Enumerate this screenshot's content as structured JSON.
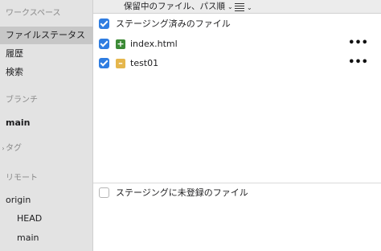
{
  "sidebar": {
    "workspace_header": "ワークスペース",
    "items": [
      {
        "label": "ファイルステータス",
        "selected": true
      },
      {
        "label": "履歴"
      },
      {
        "label": "検索"
      }
    ],
    "branches_header": "ブランチ",
    "current_branch": "main",
    "tags_header": "タグ",
    "remotes_header": "リモート",
    "remote_name": "origin",
    "remote_branches": [
      "HEAD",
      "main"
    ]
  },
  "toolbar": {
    "sort_label": "保留中のファイル、パス順",
    "chevron_icon": "chevron-down-icon",
    "view_icon": "list-icon"
  },
  "staged": {
    "header": "ステージング済みのファイル",
    "files": [
      {
        "name": "index.html",
        "status": "added",
        "status_icon": "+"
      },
      {
        "name": "test01",
        "status": "modified",
        "status_icon": "–"
      }
    ],
    "more_label": "•••"
  },
  "unstaged": {
    "header": "ステージングに未登録のファイル"
  },
  "colors": {
    "checkbox": "#2f7de1",
    "added": "#3c8a36",
    "modified": "#e5b64c",
    "sidebar_bg": "#e3e3e3",
    "selected_bg": "#c7c7c7"
  }
}
